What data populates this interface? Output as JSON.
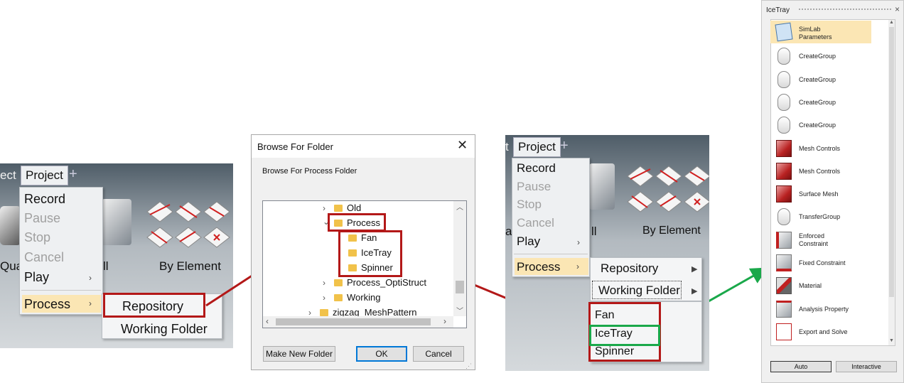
{
  "panel1": {
    "partial_tab": "ect",
    "tab": "Project",
    "plus": "+",
    "menu": {
      "record": "Record",
      "pause": "Pause",
      "stop": "Stop",
      "cancel": "Cancel",
      "play": "Play",
      "process": "Process"
    },
    "submenu": {
      "repository": "Repository",
      "working_folder": "Working Folder"
    },
    "bg_text_qua": "Qua",
    "bg_text_ll": "ll",
    "by_element": "By Element"
  },
  "dialog": {
    "title": "Browse For Folder",
    "instruction": "Browse For Process Folder",
    "tree": [
      {
        "label": "Old"
      },
      {
        "label": "Process"
      },
      {
        "label": "Fan"
      },
      {
        "label": "IceTray"
      },
      {
        "label": "Spinner"
      },
      {
        "label": "Process_OptiStruct"
      },
      {
        "label": "Working"
      },
      {
        "label": "zigzag_MeshPattern"
      }
    ],
    "make_new_folder": "Make New Folder",
    "ok": "OK",
    "cancel": "Cancel"
  },
  "panel3": {
    "partial_tab": "t",
    "tab": "Project",
    "plus": "+",
    "menu": {
      "record": "Record",
      "pause": "Pause",
      "stop": "Stop",
      "cancel": "Cancel",
      "play": "Play",
      "process": "Process"
    },
    "submenu": {
      "repository": "Repository",
      "working_folder": "Working Folder"
    },
    "submenu2": {
      "fan": "Fan",
      "icetray": "IceTray",
      "spinner": "Spinner"
    },
    "bg_text_a": "a",
    "bg_text_ll": "ll",
    "by_element": "By Element"
  },
  "icetray": {
    "title": "IceTray",
    "close": "×",
    "items": [
      {
        "label": "SimLab\nParameters",
        "icon": "document-icon"
      },
      {
        "label": "CreateGroup",
        "icon": "mouse-icon"
      },
      {
        "label": "CreateGroup",
        "icon": "mouse-icon"
      },
      {
        "label": "CreateGroup",
        "icon": "mouse-icon"
      },
      {
        "label": "CreateGroup",
        "icon": "mouse-icon"
      },
      {
        "label": "Mesh Controls",
        "icon": "mesh-icon"
      },
      {
        "label": "Mesh Controls",
        "icon": "mesh-icon"
      },
      {
        "label": "Surface Mesh",
        "icon": "mesh-icon"
      },
      {
        "label": "TransferGroup",
        "icon": "mouse-icon"
      },
      {
        "label": "Enforced\nConstraint",
        "icon": "constraint-icon"
      },
      {
        "label": "Fixed Constraint",
        "icon": "constraint-icon"
      },
      {
        "label": "Material",
        "icon": "material-icon"
      },
      {
        "label": "Analysis Property",
        "icon": "property-icon"
      },
      {
        "label": "Export and Solve",
        "icon": "export-icon"
      }
    ],
    "auto": "Auto",
    "interactive": "Interactive"
  }
}
